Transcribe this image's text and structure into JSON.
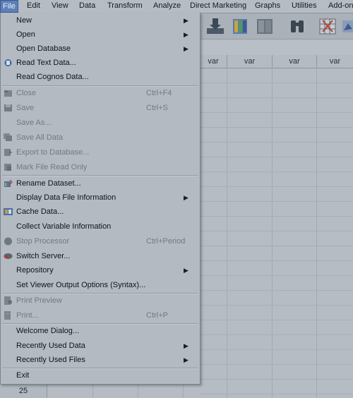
{
  "menubar": [
    "File",
    "Edit",
    "View",
    "Data",
    "Transform",
    "Analyze",
    "Direct Marketing",
    "Graphs",
    "Utilities",
    "Add-ons"
  ],
  "columns": [
    "var",
    "var",
    "var",
    "var"
  ],
  "row_number": "25",
  "colors": {
    "menu_bg": "#b3bac2",
    "highlight": "#5f7fb8",
    "disabled_text": "#717982"
  },
  "file_menu": {
    "new": "New",
    "open": "Open",
    "open_database": "Open Database",
    "read_text_data": "Read Text Data...",
    "read_cognos_data": "Read Cognos Data...",
    "close": "Close",
    "close_shortcut": "Ctrl+F4",
    "save": "Save",
    "save_shortcut": "Ctrl+S",
    "save_as": "Save As...",
    "save_all_data": "Save All Data",
    "export_to_database": "Export to Database...",
    "mark_file_read_only": "Mark File Read Only",
    "rename_dataset": "Rename Dataset...",
    "display_data_file_information": "Display Data File Information",
    "cache_data": "Cache Data...",
    "collect_variable_information": "Collect Variable Information",
    "stop_processor": "Stop Processor",
    "stop_processor_shortcut": "Ctrl+Period",
    "switch_server": "Switch Server...",
    "repository": "Repository",
    "set_viewer_output_options": "Set Viewer Output Options (Syntax)...",
    "print_preview": "Print Preview",
    "print": "Print...",
    "print_shortcut": "Ctrl+P",
    "welcome_dialog": "Welcome Dialog...",
    "recently_used_data": "Recently Used Data",
    "recently_used_files": "Recently Used Files",
    "exit": "Exit"
  }
}
